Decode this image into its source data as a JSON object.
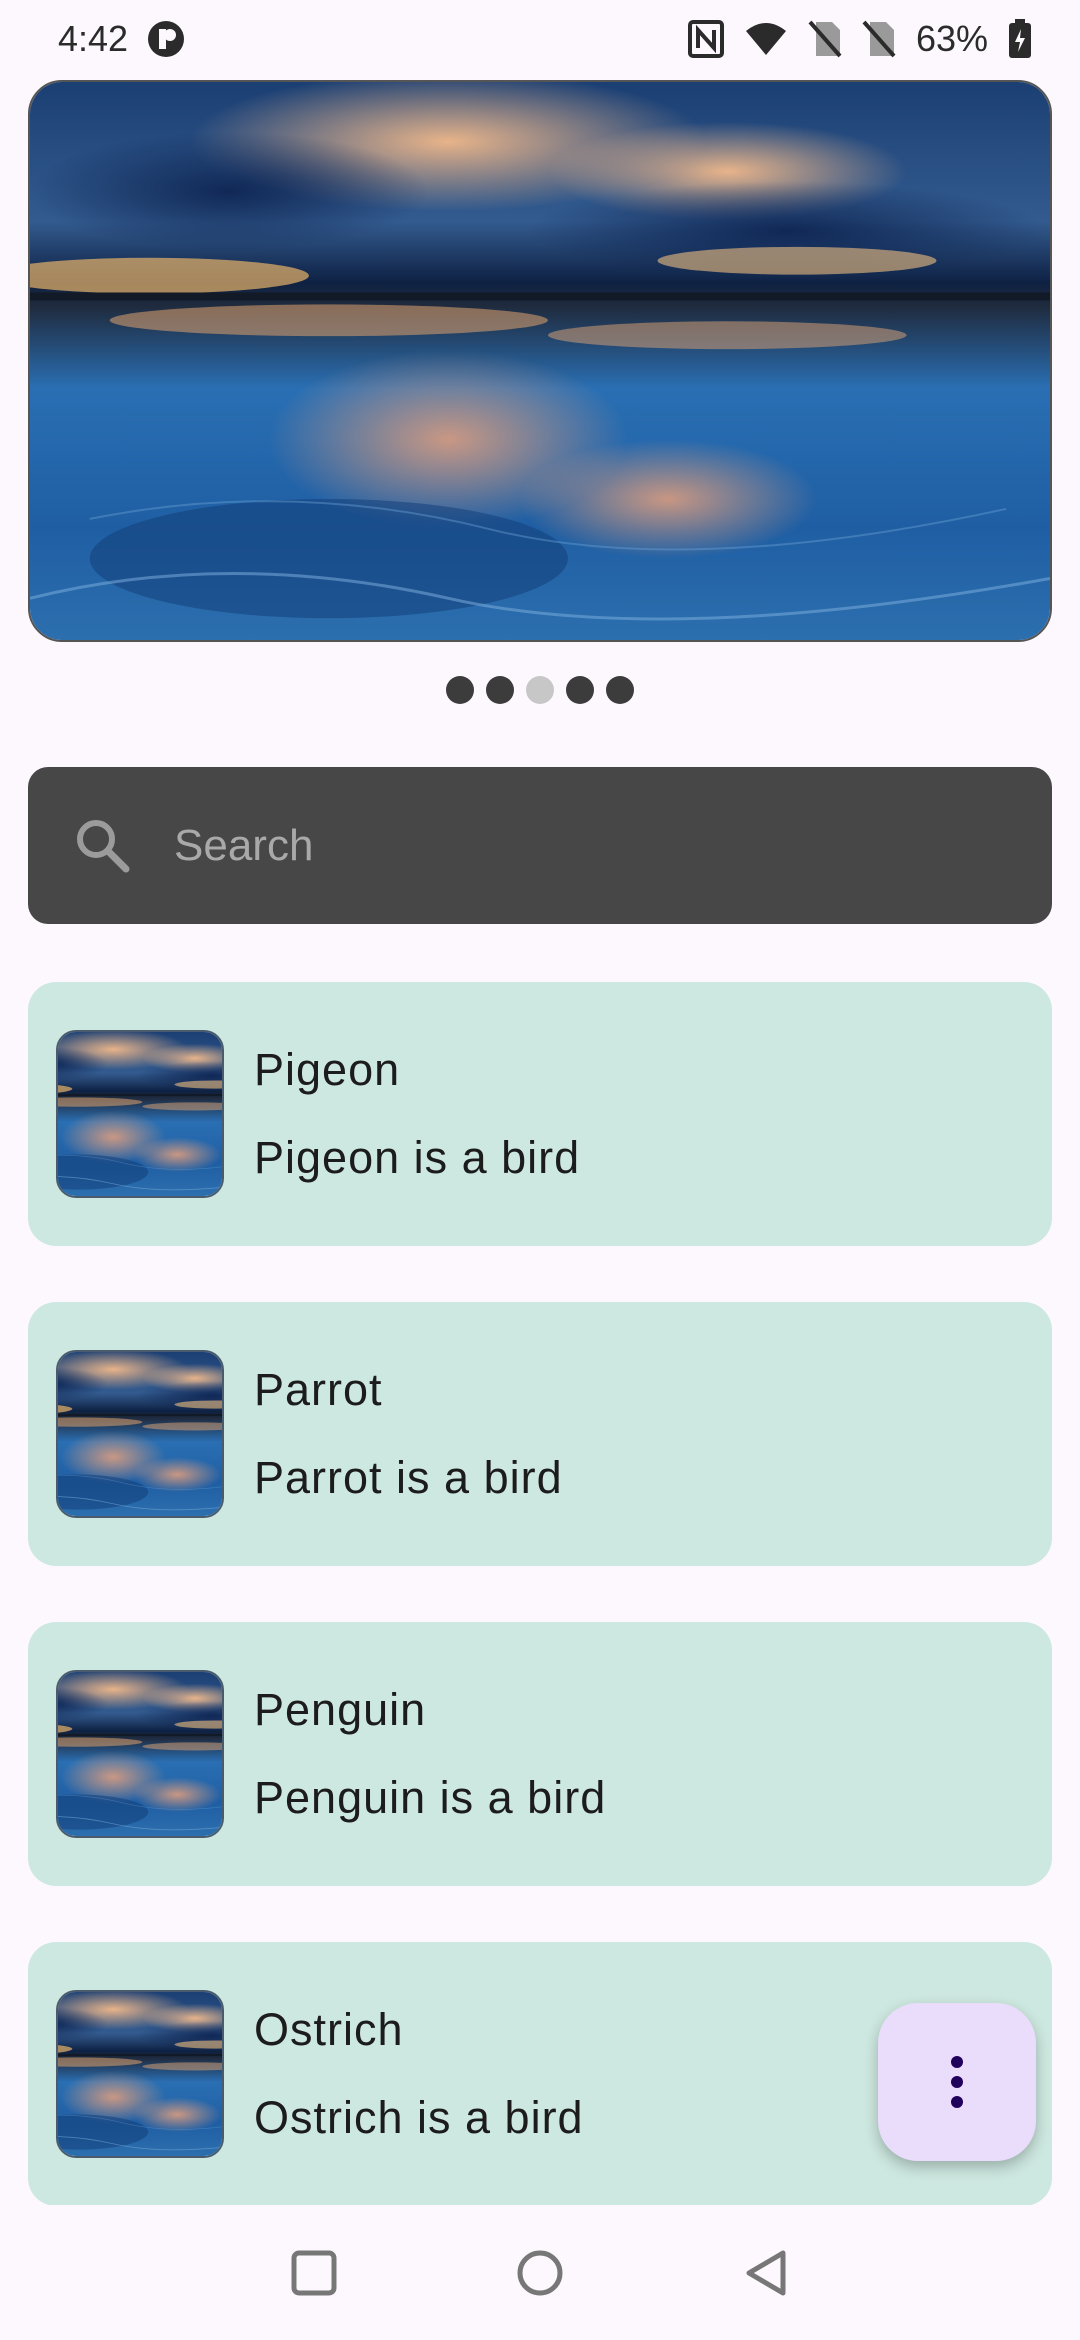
{
  "status_bar": {
    "time": "4:42",
    "battery": "63%",
    "icons": [
      "notification-app-icon",
      "nfc-icon",
      "wifi-icon",
      "no-sim-icon",
      "no-sim-icon",
      "battery-charging-icon"
    ]
  },
  "carousel": {
    "image": "lake-sunset-reflection",
    "dots": [
      {
        "active": false
      },
      {
        "active": false
      },
      {
        "active": true
      },
      {
        "active": false
      },
      {
        "active": false
      }
    ]
  },
  "search": {
    "placeholder": "Search",
    "value": ""
  },
  "list": {
    "items": [
      {
        "title": "Pigeon",
        "subtitle": "Pigeon is a bird"
      },
      {
        "title": "Parrot",
        "subtitle": "Parrot is a bird"
      },
      {
        "title": "Penguin",
        "subtitle": "Penguin is a bird"
      },
      {
        "title": "Ostrich",
        "subtitle": "Ostrich is a bird"
      }
    ]
  },
  "fab": {
    "icon": "more-vert-icon"
  },
  "nav_bar": {
    "buttons": [
      "recents-icon",
      "home-icon",
      "back-icon"
    ]
  },
  "colors": {
    "background": "#fdf8fd",
    "card": "#cde8e0",
    "search_bg": "#474747",
    "fab": "#eadcfb"
  }
}
